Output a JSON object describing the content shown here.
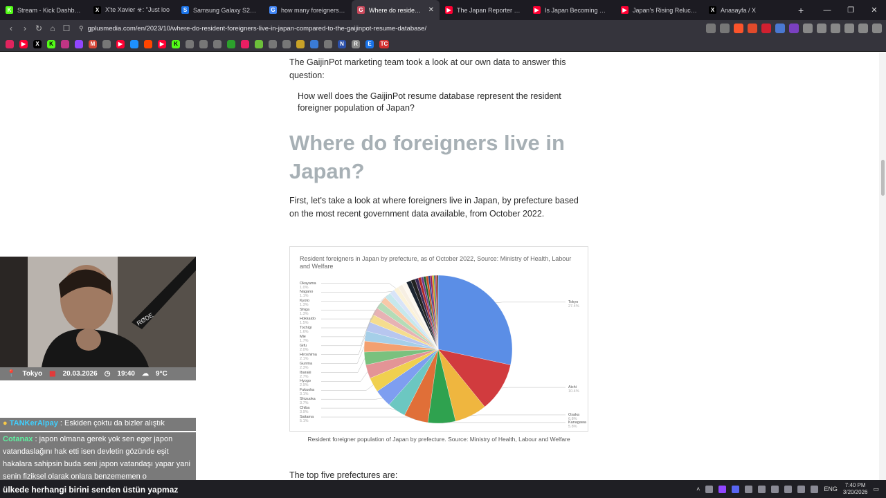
{
  "tabs": [
    {
      "title": "Stream - Kick Dashboard",
      "color": "#53fc18",
      "glyph": "K"
    },
    {
      "title": "X'te Xavier ☣: \"Just loo",
      "color": "#000000",
      "glyph": "X"
    },
    {
      "title": "Samsung Galaxy S26 Ultra",
      "color": "#1a73e8",
      "glyph": "S"
    },
    {
      "title": "how many foreigners live i",
      "color": "#4285f4",
      "glyph": "G"
    },
    {
      "title": "Where do resident fo",
      "color": "#c9485b",
      "glyph": "G"
    },
    {
      "title": "The Japan Reporter - YouT",
      "color": "#ff0033",
      "glyph": "▶"
    },
    {
      "title": "Is Japan Becoming More X",
      "color": "#ff0033",
      "glyph": "▶"
    },
    {
      "title": "Japan's Rising Reluctance",
      "color": "#ff0033",
      "glyph": "▶"
    },
    {
      "title": "Anasayfa / X",
      "color": "#000000",
      "glyph": "X"
    }
  ],
  "url": "gplusmedia.com/en/2023/10/where-do-resident-foreigners-live-in-japan-compared-to-the-gaijinpot-resume-database/",
  "article": {
    "intro": "The GaijinPot marketing team took a look at our own data to answer this question:",
    "quote": "How well does the GaijinPot resume database represent the resident foreigner population of Japan?",
    "heading": "Where do foreigners live in Japan?",
    "para": "First, let's take a look at where foreigners live in Japan, by prefecture based on the most recent government data available, from October 2022.",
    "chart_title": "Resident foreigners in Japan by prefecture, as of October 2022, Source: Ministry of Health, Labour and Welfare",
    "caption": "Resident foreigner population of Japan by prefecture. Source: Ministry of Health, Labour and Welfare",
    "top5": "The top five prefectures are:"
  },
  "chart_data": {
    "type": "pie",
    "title": "Resident foreigners in Japan by prefecture, as of October 2022, Source: Ministry of Health, Labour and Welfare",
    "slices": [
      {
        "label": "Tokyo",
        "value": 27.4,
        "pct_text": "27.4%",
        "color": "#5b8ee6"
      },
      {
        "label": "Aichi",
        "value": 10.4,
        "pct_text": "10.4%",
        "color": "#d13b3e"
      },
      {
        "label": "Osaka",
        "value": 6.8,
        "pct_text": "6.8%",
        "color": "#efb63f"
      },
      {
        "label": "Kanagawa",
        "value": 5.8,
        "pct_text": "5.8%",
        "color": "#2fa24f"
      },
      {
        "label": "Saitama",
        "value": 5.1,
        "pct_text": "5.1%",
        "color": "#e06f38"
      },
      {
        "label": "Chiba",
        "value": 3.9,
        "pct_text": "3.9%",
        "color": "#6cc7c1"
      },
      {
        "label": "Shizuoka",
        "value": 3.7,
        "pct_text": "3.7%",
        "color": "#7e9ef0"
      },
      {
        "label": "Fukuoka",
        "value": 3.1,
        "pct_text": "3.1%",
        "color": "#f0d04f"
      },
      {
        "label": "Hyogo",
        "value": 2.9,
        "pct_text": "2.9%",
        "color": "#e39496"
      },
      {
        "label": "Ibaraki",
        "value": 2.7,
        "pct_text": "2.7%",
        "color": "#7ac17e"
      },
      {
        "label": "Gunma",
        "value": 2.3,
        "pct_text": "2.3%",
        "color": "#f3a070"
      },
      {
        "label": "Hiroshima",
        "value": 2.1,
        "pct_text": "2.1%",
        "color": "#a5cfe8"
      },
      {
        "label": "Gifu",
        "value": 2.0,
        "pct_text": "2.0%",
        "color": "#b7c6ef"
      },
      {
        "label": "Mie",
        "value": 1.7,
        "pct_text": "1.7%",
        "color": "#f5dd8f"
      },
      {
        "label": "Tochigi",
        "value": 1.6,
        "pct_text": "1.6%",
        "color": "#e7b2b4"
      },
      {
        "label": "Hokkaido",
        "value": 1.5,
        "pct_text": "1.5%",
        "color": "#b4dcb7"
      },
      {
        "label": "Shiga",
        "value": 1.3,
        "pct_text": "1.3%",
        "color": "#f8c8a8"
      },
      {
        "label": "Kyoto",
        "value": 1.3,
        "pct_text": "1.3%",
        "color": "#c6e8ec"
      },
      {
        "label": "Nagano",
        "value": 1.1,
        "pct_text": "1.1%",
        "color": "#d8e4f8"
      },
      {
        "label": "Okayama",
        "value": 1.0,
        "pct_text": "1.0%",
        "color": "#fbf2d8"
      },
      {
        "label": "",
        "value": 1.0,
        "pct_text": "",
        "color": "#f7efe3"
      },
      {
        "label": "",
        "value": 1.0,
        "pct_text": "",
        "color": "#fdf8f0"
      },
      {
        "label": "",
        "value": 1.0,
        "pct_text": "",
        "color": "#1c2530"
      },
      {
        "label": "",
        "value": 0.9,
        "pct_text": "",
        "color": "#222222"
      },
      {
        "label": "",
        "value": 0.7,
        "pct_text": "",
        "color": "#3b2a55"
      },
      {
        "label": "",
        "value": 0.6,
        "pct_text": "",
        "color": "#b0282a"
      },
      {
        "label": "",
        "value": 0.5,
        "pct_text": "",
        "color": "#6a3d8a"
      },
      {
        "label": "",
        "value": 0.5,
        "pct_text": "",
        "color": "#1d5e2e"
      },
      {
        "label": "",
        "value": 0.5,
        "pct_text": "",
        "color": "#c4511d"
      },
      {
        "label": "",
        "value": 0.4,
        "pct_text": "",
        "color": "#2b3f8c"
      },
      {
        "label": "",
        "value": 0.4,
        "pct_text": "",
        "color": "#9a1b5a"
      },
      {
        "label": "",
        "value": 0.4,
        "pct_text": "",
        "color": "#d4a017"
      },
      {
        "label": "",
        "value": 0.3,
        "pct_text": "",
        "color": "#246b78"
      },
      {
        "label": "",
        "value": 0.3,
        "pct_text": "",
        "color": "#c43c52"
      },
      {
        "label": "",
        "value": 0.3,
        "pct_text": "",
        "color": "#5a3c20"
      }
    ]
  },
  "cam": {
    "city": "Tokyo",
    "date": "20.03.2026",
    "time": "19:40",
    "temp": "9°C",
    "mic_label": "RØDE"
  },
  "chat": [
    {
      "user": "TANKerAlpay",
      "text": ": Eskiden çoktu da bizler alıştık"
    },
    {
      "user": "Cotanax",
      "text": ": japon olmana gerek yok sen eger japon vatandaslağını hak etti isen devletin gözünde eşit hakalara sahipsin buda seni japon vatandaşı yapar yani senin fiziksel olarak onlara benzememen o"
    }
  ],
  "chat_overlay": "ülkede herhangi birini senden üstün yapmaz",
  "taskbar": {
    "lang": "ENG",
    "time": "7:40 PM",
    "date": "3/20/2026"
  }
}
